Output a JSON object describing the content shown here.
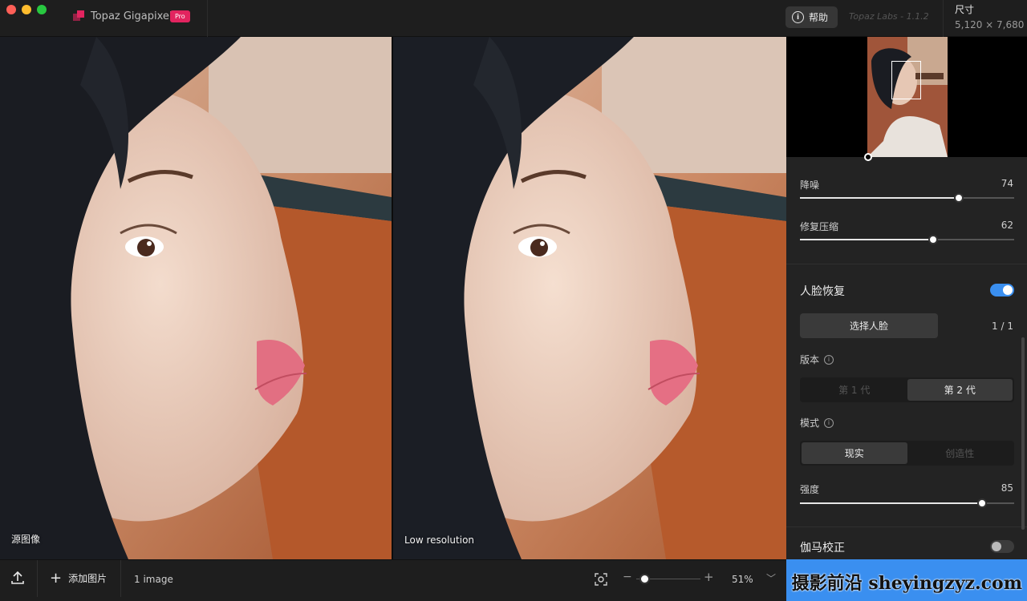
{
  "app": {
    "name": "Topaz Gigapixel",
    "badge": "Pro",
    "version": "Topaz Labs - 1.1.2"
  },
  "header": {
    "help_label": "帮助",
    "size_label": "尺寸",
    "size_value": "5,120 × 7,680"
  },
  "panes": {
    "left_label": "源图像",
    "right_label": "Low resolution"
  },
  "sidebar": {
    "denoise": {
      "label": "降噪",
      "value": "74",
      "fraction": 0.74
    },
    "fix_compression": {
      "label": "修复压缩",
      "value": "62",
      "fraction": 0.62
    },
    "face_recovery": {
      "title": "人脸恢复",
      "enabled": true,
      "select_face_label": "选择人脸",
      "face_count": "1 / 1",
      "version_label": "版本",
      "versions": [
        "第 1 代",
        "第 2 代"
      ],
      "selected_version": 1,
      "mode_label": "模式",
      "modes": [
        "现实",
        "创造性"
      ],
      "selected_mode": 0,
      "strength": {
        "label": "强度",
        "value": "85",
        "fraction": 0.85
      }
    },
    "gamma": {
      "title": "伽马校正",
      "enabled": false
    }
  },
  "bottom": {
    "add_image_label": "添加图片",
    "image_count": "1 image",
    "zoom_value": "51%",
    "zoom_fraction": 0.05
  },
  "watermark": "摄影前沿 sheyingzyz.com",
  "colors": {
    "accent": "#3a8ff0",
    "pro_badge": "#e2245f"
  }
}
